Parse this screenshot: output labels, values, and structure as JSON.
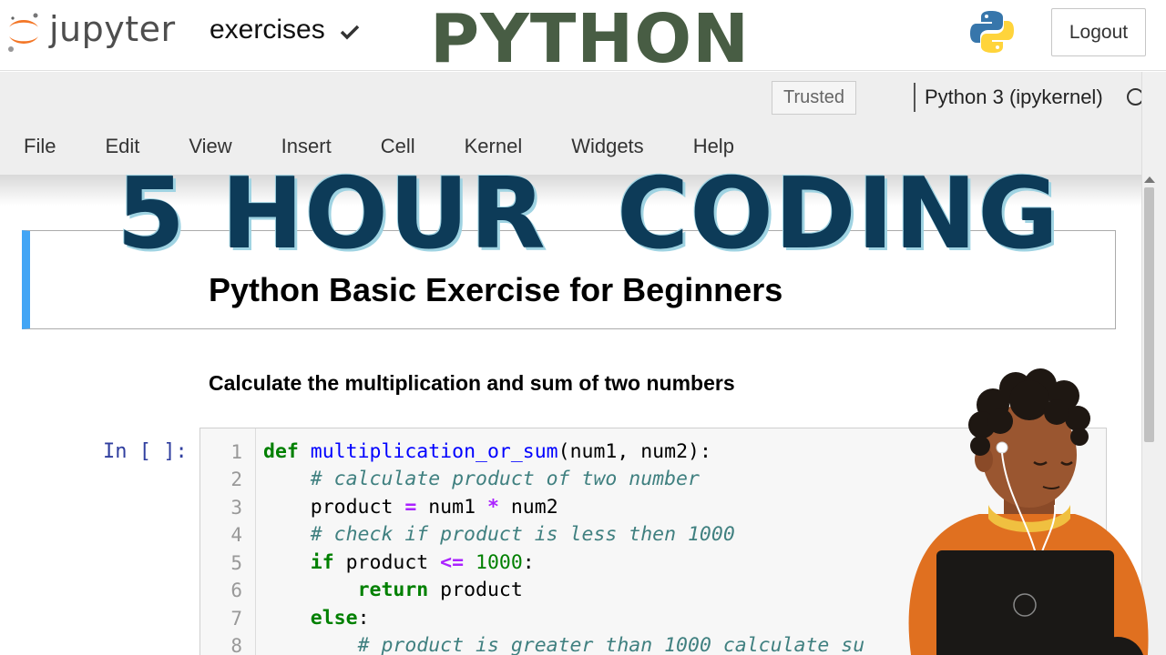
{
  "header": {
    "logo_text": "jupyter",
    "notebook_name": "exercises",
    "overlay_title": "PYTHON",
    "logout_label": "Logout"
  },
  "toolbar": {
    "trusted_label": "Trusted",
    "kernel_name": "Python 3 (ipykernel)"
  },
  "menu": [
    "File",
    "Edit",
    "View",
    "Insert",
    "Cell",
    "Kernel",
    "Widgets",
    "Help"
  ],
  "overlay": {
    "headline": "5 HOUR  CODING"
  },
  "markdown_cell": {
    "title": "Python Basic Exercise for Beginners"
  },
  "subheading": "Calculate the multiplication and sum of two numbers",
  "code_cell": {
    "prompt": "In [ ]:",
    "line_numbers": [
      "1",
      "2",
      "3",
      "4",
      "5",
      "6",
      "7",
      "8"
    ],
    "lines": {
      "l1_def": "def",
      "l1_fn": "multiplication_or_sum",
      "l1_rest": "(num1, num2):",
      "l2_comment": "# calculate product of two number",
      "l3_a": "product ",
      "l3_eq": "=",
      "l3_b": " num1 ",
      "l3_mul": "*",
      "l3_c": " num2",
      "l4_comment": "# check if product is less then 1000",
      "l5_if": "if",
      "l5_a": " product ",
      "l5_le": "<=",
      "l5_num": "1000",
      "l5_colon": ":",
      "l6_return": "return",
      "l6_rest": " product",
      "l7_else": "else",
      "l7_colon": ":",
      "l8_comment": "# product is greater than 1000 calculate su"
    }
  },
  "colors": {
    "accent_blue": "#42a5f5",
    "headline_navy": "#0d3b58",
    "python_green": "#485d44",
    "jupyter_orange": "#f37626"
  },
  "icons": [
    "jupyter-logo-icon",
    "checkmark-icon",
    "python-logo-icon",
    "kernel-idle-icon"
  ]
}
